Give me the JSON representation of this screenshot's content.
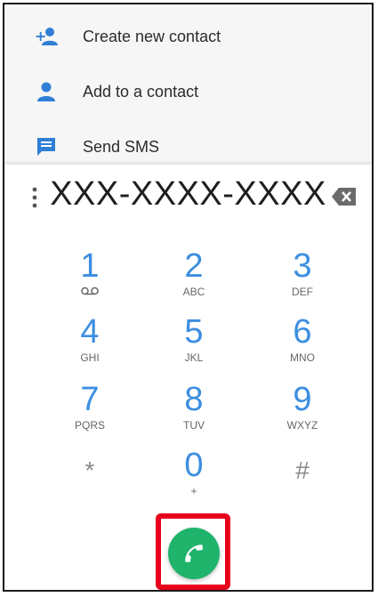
{
  "suggestions": [
    {
      "label": "Create new contact",
      "icon": "add-person-icon"
    },
    {
      "label": "Add to a contact",
      "icon": "person-icon"
    },
    {
      "label": "Send SMS",
      "icon": "message-icon"
    }
  ],
  "entry": {
    "number": "XXX-XXXX-XXXX",
    "menu_icon": "more-vert-icon",
    "backspace_icon": "backspace-icon"
  },
  "keypad": [
    {
      "digit": "1",
      "letters": "",
      "icon": "voicemail-icon"
    },
    {
      "digit": "2",
      "letters": "ABC"
    },
    {
      "digit": "3",
      "letters": "DEF"
    },
    {
      "digit": "4",
      "letters": "GHI"
    },
    {
      "digit": "5",
      "letters": "JKL"
    },
    {
      "digit": "6",
      "letters": "MNO"
    },
    {
      "digit": "7",
      "letters": "PQRS"
    },
    {
      "digit": "8",
      "letters": "TUV"
    },
    {
      "digit": "9",
      "letters": "WXYZ"
    },
    {
      "digit": "*",
      "letters": ""
    },
    {
      "digit": "0",
      "letters": "+"
    },
    {
      "digit": "#",
      "letters": ""
    }
  ],
  "call": {
    "icon": "phone-icon"
  },
  "colors": {
    "accent": "#3c8ee0",
    "suggestion_icon": "#2f7fd6",
    "call_green": "#1fb36b",
    "highlight_red": "#e8001c"
  }
}
